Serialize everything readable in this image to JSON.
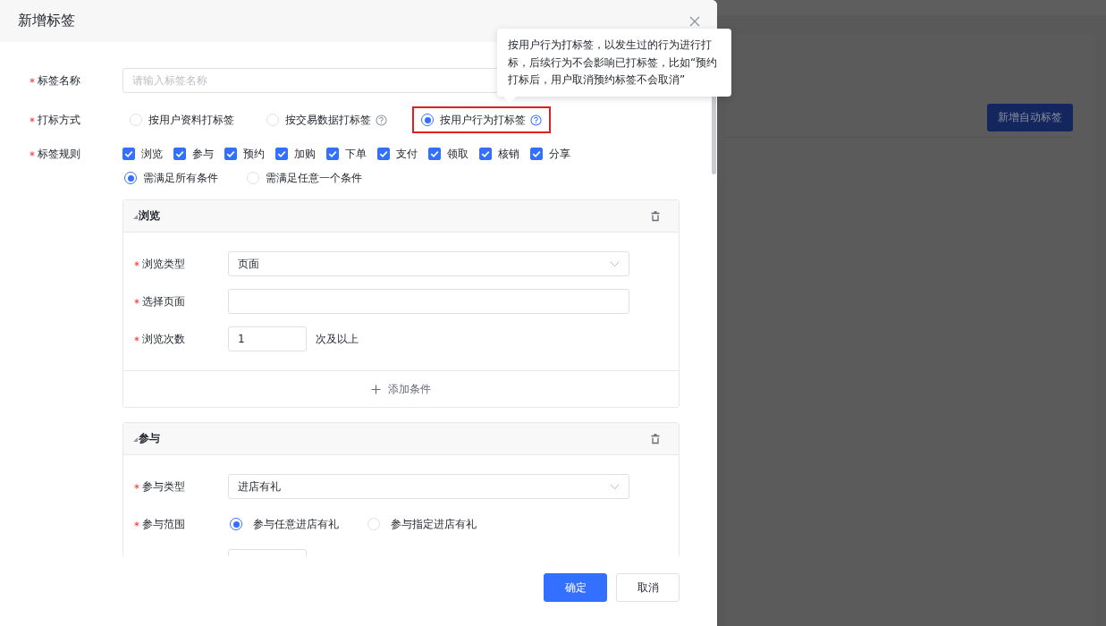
{
  "background_page": {
    "button": "新增自动标签"
  },
  "dialog": {
    "title": "新增标签",
    "name_field": {
      "label": "标签名称",
      "required": true,
      "placeholder": "请输入标签名称"
    },
    "method_field": {
      "label": "打标方式",
      "required": true,
      "options": [
        {
          "label": "按用户资料打标签",
          "selected": false,
          "help": false,
          "highlighted": false
        },
        {
          "label": "按交易数据打标签",
          "selected": false,
          "help": true,
          "highlighted": false
        },
        {
          "label": "按用户行为打标签",
          "selected": true,
          "help": true,
          "highlighted": true
        }
      ]
    },
    "rules_field": {
      "label": "标签规则",
      "required": true,
      "options": [
        {
          "label": "浏览",
          "checked": true
        },
        {
          "label": "参与",
          "checked": true
        },
        {
          "label": "预约",
          "checked": true
        },
        {
          "label": "加购",
          "checked": true
        },
        {
          "label": "下单",
          "checked": true
        },
        {
          "label": "支付",
          "checked": true
        },
        {
          "label": "领取",
          "checked": true
        },
        {
          "label": "核销",
          "checked": true
        },
        {
          "label": "分享",
          "checked": true
        }
      ],
      "match_options": [
        {
          "label": "需满足所有条件",
          "selected": true
        },
        {
          "label": "需满足任意一个条件",
          "selected": false
        }
      ]
    },
    "rule_cards": [
      {
        "title": "浏览",
        "rows": [
          {
            "kind": "select",
            "label": "浏览类型",
            "required": true,
            "value": "页面"
          },
          {
            "kind": "input",
            "label": "选择页面",
            "required": true
          },
          {
            "kind": "number",
            "label": "浏览次数",
            "required": true,
            "value": "1",
            "suffix": "次及以上"
          }
        ],
        "add_label": "添加条件"
      },
      {
        "title": "参与",
        "rows": [
          {
            "kind": "select",
            "label": "参与类型",
            "required": true,
            "value": "进店有礼"
          },
          {
            "kind": "radio",
            "label": "参与范围",
            "required": true,
            "options": [
              {
                "label": "参与任意进店有礼",
                "selected": true
              },
              {
                "label": "参与指定进店有礼",
                "selected": false
              }
            ]
          },
          {
            "kind": "number"
          }
        ]
      }
    ],
    "buttons": [
      {
        "label": "确定",
        "kind": "primary"
      },
      {
        "label": "取消",
        "kind": "default"
      }
    ],
    "tooltip": {
      "text": "按用户行为打标签，以发生过的行为进行打标，后续行为不会影响已打标签，比如“预约打标后，用户取消预约标签不会取消”"
    }
  }
}
